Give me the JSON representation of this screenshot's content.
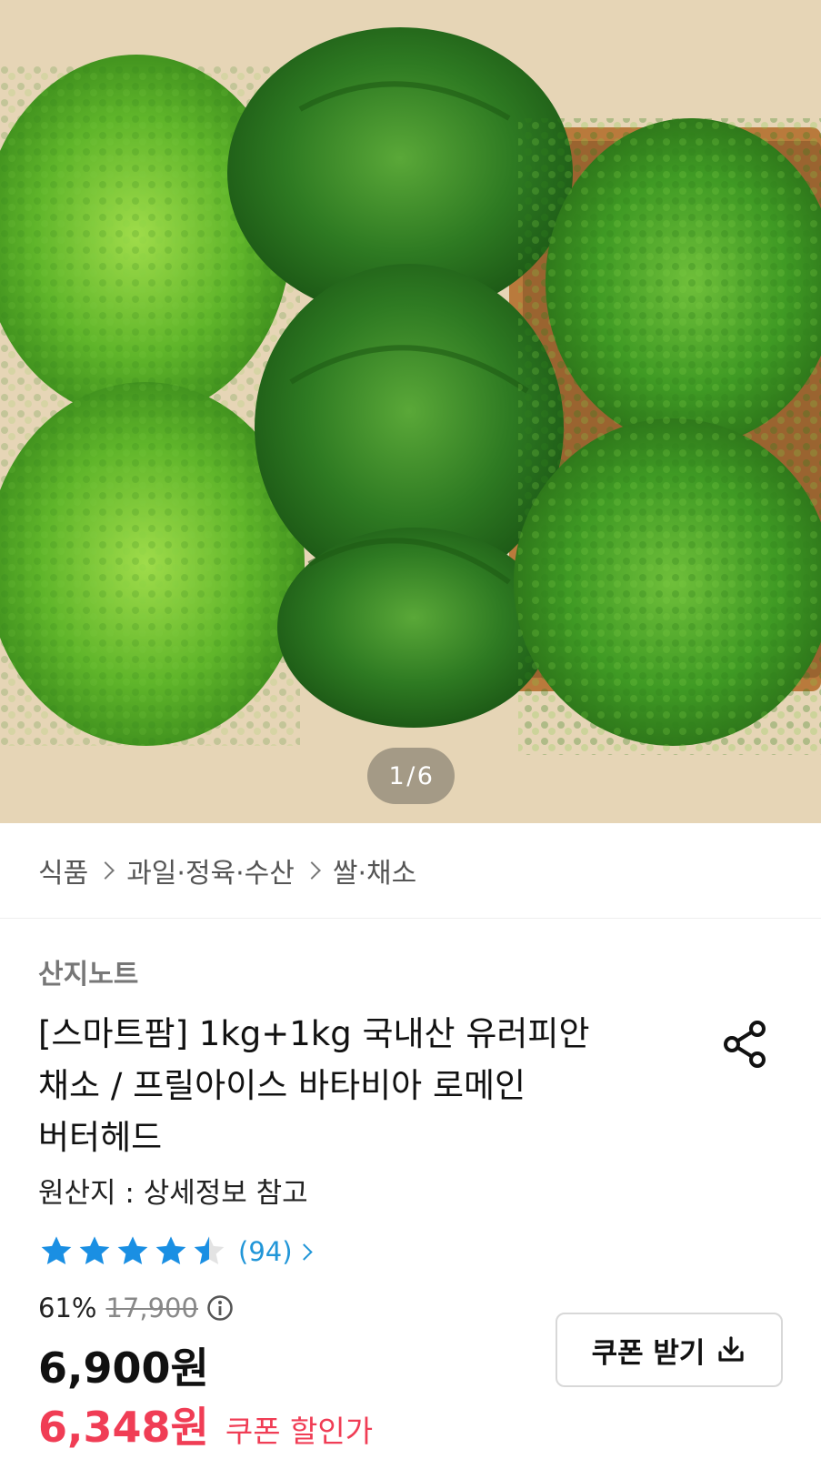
{
  "gallery": {
    "current": "1",
    "separator": "/",
    "total": "6"
  },
  "breadcrumb": [
    "식품",
    "과일·정육·수산",
    "쌀·채소"
  ],
  "product": {
    "seller": "산지노트",
    "title_lines": [
      "[스마트팜] 1kg+1kg 국내산 유러피안",
      "채소 / 프릴아이스 바타비아 로메인",
      "버터헤드"
    ],
    "origin": "원산지 : 상세정보 참고",
    "rating": 4.5,
    "review_count": "(94)",
    "discount_rate": "61%",
    "original_price": "17,900",
    "price": "6,900원",
    "coupon_price": "6,348원",
    "coupon_price_label": "쿠폰 할인가",
    "coupon_button_label": "쿠폰 받기"
  },
  "icons": {
    "share": "share-icon",
    "info": "info-icon",
    "download": "download-icon",
    "star": "star-icon"
  },
  "colors": {
    "star": "#1a8fe3",
    "review_link": "#2196d8",
    "coupon_price": "#f03d55"
  }
}
